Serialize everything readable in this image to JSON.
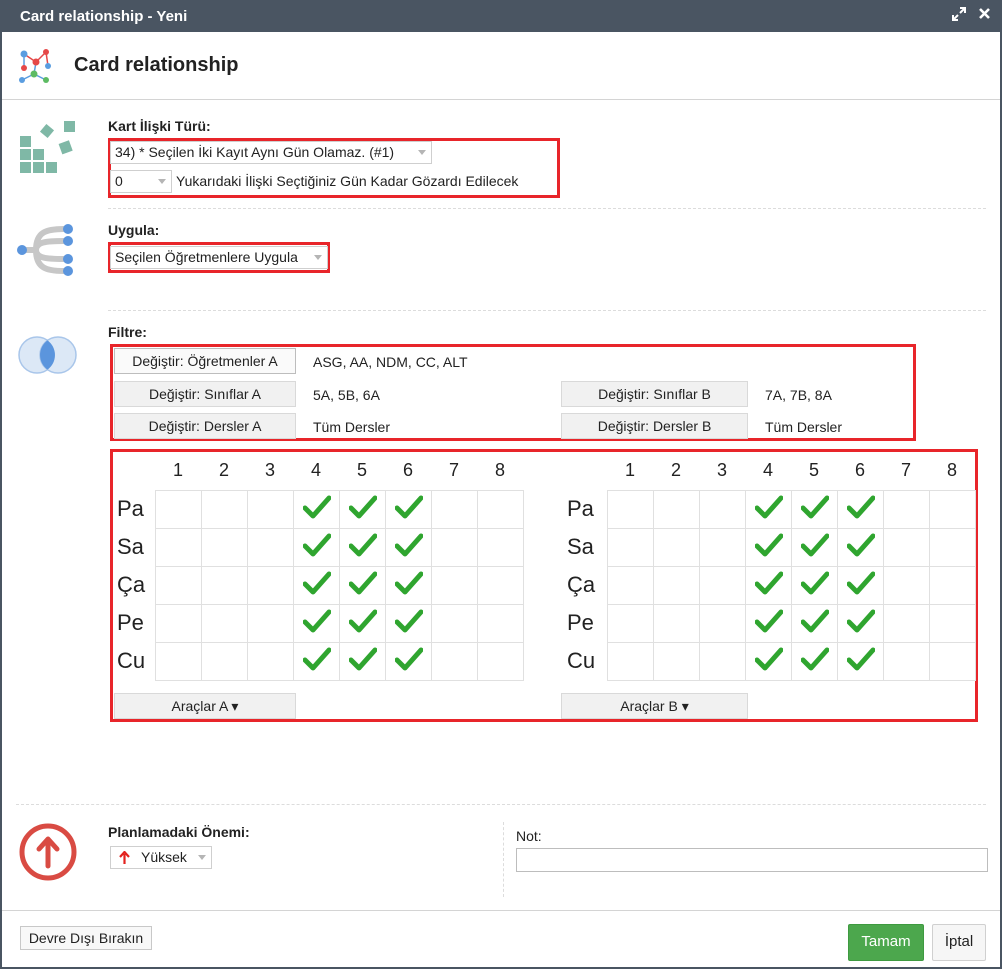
{
  "window": {
    "title": "Card relationship - Yeni",
    "heading": "Card relationship"
  },
  "relation_type": {
    "label": "Kart İlişki Türü:",
    "selected": "34) * Seçilen İki Kayıt Aynı Gün Olamaz. (#1)",
    "ignore_days_value": "0",
    "ignore_days_text": "Yukarıdaki İlişki Seçtiğiniz Gün Kadar Gözardı Edilecek"
  },
  "apply": {
    "label": "Uygula:",
    "selected": "Seçilen Öğretmenlere Uygula"
  },
  "filter": {
    "label": "Filtre:",
    "teachers_a_button": "Değiştir: Öğretmenler A",
    "teachers_a_value": "ASG, AA, NDM, CC, ALT",
    "classes_a_button": "Değiştir: Sınıflar A",
    "classes_a_value": "5A, 5B, 6A",
    "classes_b_button": "Değiştir: Sınıflar B",
    "classes_b_value": "7A, 7B, 8A",
    "lessons_a_button": "Değiştir: Dersler A",
    "lessons_a_value": "Tüm Dersler",
    "lessons_b_button": "Değiştir: Dersler B",
    "lessons_b_value": "Tüm Dersler"
  },
  "schedule": {
    "periods": [
      "1",
      "2",
      "3",
      "4",
      "5",
      "6",
      "7",
      "8"
    ],
    "days": [
      "Pa",
      "Sa",
      "Ça",
      "Pe",
      "Cu"
    ],
    "checked_periods_a": [
      4,
      5,
      6
    ],
    "checked_periods_b": [
      4,
      5,
      6
    ],
    "tools_a": "Araçlar A ▾",
    "tools_b": "Araçlar B ▾",
    "check_color": "#2fa52f"
  },
  "importance": {
    "label": "Planlamadaki Önemi:",
    "selected": "Yüksek",
    "note_label": "Not:",
    "note_value": ""
  },
  "footer": {
    "disable_button": "Devre Dışı Bırakın",
    "ok_button": "Tamam",
    "cancel_button": "İptal"
  },
  "colors": {
    "titlebar": "#4a5562",
    "highlight_border": "#e8252a",
    "ok_button": "#4ca74d"
  }
}
